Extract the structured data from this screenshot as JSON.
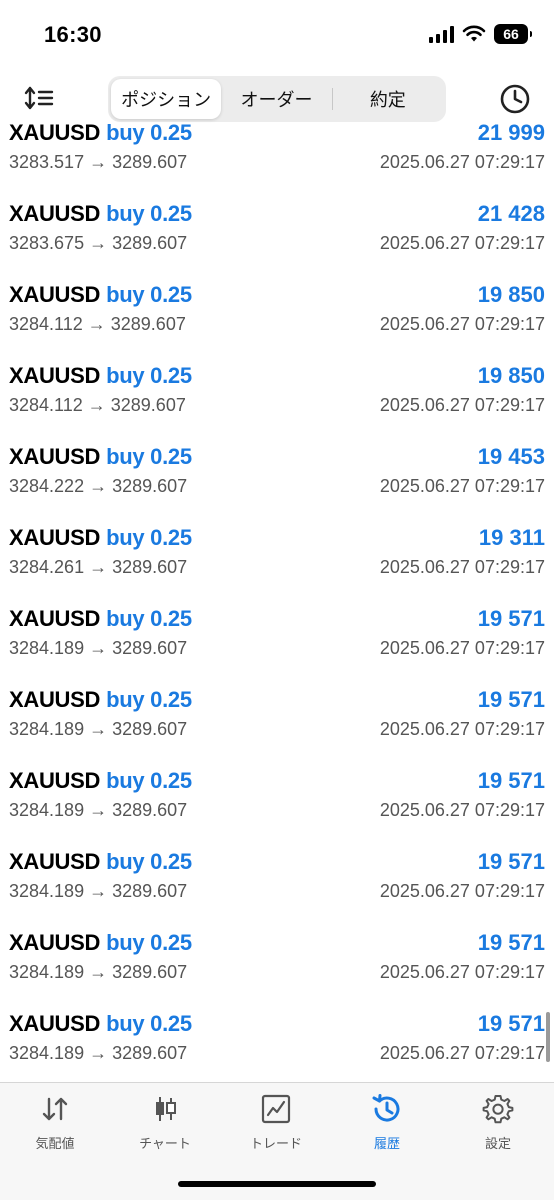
{
  "status_bar": {
    "time": "16:30",
    "battery": "66"
  },
  "toolbar": {
    "segments": [
      "ポジション",
      "オーダー",
      "約定"
    ],
    "active_segment": "ポジション"
  },
  "deals": [
    {
      "symbol": "XAUUSD",
      "side": "buy 0.25",
      "profit": "21 999",
      "open_price": "3283.517",
      "close_price": "3289.607",
      "time": "2025.06.27 07:29:17"
    },
    {
      "symbol": "XAUUSD",
      "side": "buy 0.25",
      "profit": "21 428",
      "open_price": "3283.675",
      "close_price": "3289.607",
      "time": "2025.06.27 07:29:17"
    },
    {
      "symbol": "XAUUSD",
      "side": "buy 0.25",
      "profit": "19 850",
      "open_price": "3284.112",
      "close_price": "3289.607",
      "time": "2025.06.27 07:29:17"
    },
    {
      "symbol": "XAUUSD",
      "side": "buy 0.25",
      "profit": "19 850",
      "open_price": "3284.112",
      "close_price": "3289.607",
      "time": "2025.06.27 07:29:17"
    },
    {
      "symbol": "XAUUSD",
      "side": "buy 0.25",
      "profit": "19 453",
      "open_price": "3284.222",
      "close_price": "3289.607",
      "time": "2025.06.27 07:29:17"
    },
    {
      "symbol": "XAUUSD",
      "side": "buy 0.25",
      "profit": "19 311",
      "open_price": "3284.261",
      "close_price": "3289.607",
      "time": "2025.06.27 07:29:17"
    },
    {
      "symbol": "XAUUSD",
      "side": "buy 0.25",
      "profit": "19 571",
      "open_price": "3284.189",
      "close_price": "3289.607",
      "time": "2025.06.27 07:29:17"
    },
    {
      "symbol": "XAUUSD",
      "side": "buy 0.25",
      "profit": "19 571",
      "open_price": "3284.189",
      "close_price": "3289.607",
      "time": "2025.06.27 07:29:17"
    },
    {
      "symbol": "XAUUSD",
      "side": "buy 0.25",
      "profit": "19 571",
      "open_price": "3284.189",
      "close_price": "3289.607",
      "time": "2025.06.27 07:29:17"
    },
    {
      "symbol": "XAUUSD",
      "side": "buy 0.25",
      "profit": "19 571",
      "open_price": "3284.189",
      "close_price": "3289.607",
      "time": "2025.06.27 07:29:17"
    },
    {
      "symbol": "XAUUSD",
      "side": "buy 0.25",
      "profit": "19 571",
      "open_price": "3284.189",
      "close_price": "3289.607",
      "time": "2025.06.27 07:29:17"
    },
    {
      "symbol": "XAUUSD",
      "side": "buy 0.25",
      "profit": "19 571",
      "open_price": "3284.189",
      "close_price": "3289.607",
      "time": "2025.06.27 07:29:17"
    }
  ],
  "tabbar": {
    "tabs": [
      {
        "label": "気配値",
        "icon": "quotes-icon"
      },
      {
        "label": "チャート",
        "icon": "chart-icon"
      },
      {
        "label": "トレード",
        "icon": "trade-icon"
      },
      {
        "label": "履歴",
        "icon": "history-icon"
      },
      {
        "label": "設定",
        "icon": "settings-icon"
      }
    ],
    "active_tab": "履歴"
  },
  "colors": {
    "accent": "#1a7ae0",
    "secondary_text": "#555555"
  }
}
